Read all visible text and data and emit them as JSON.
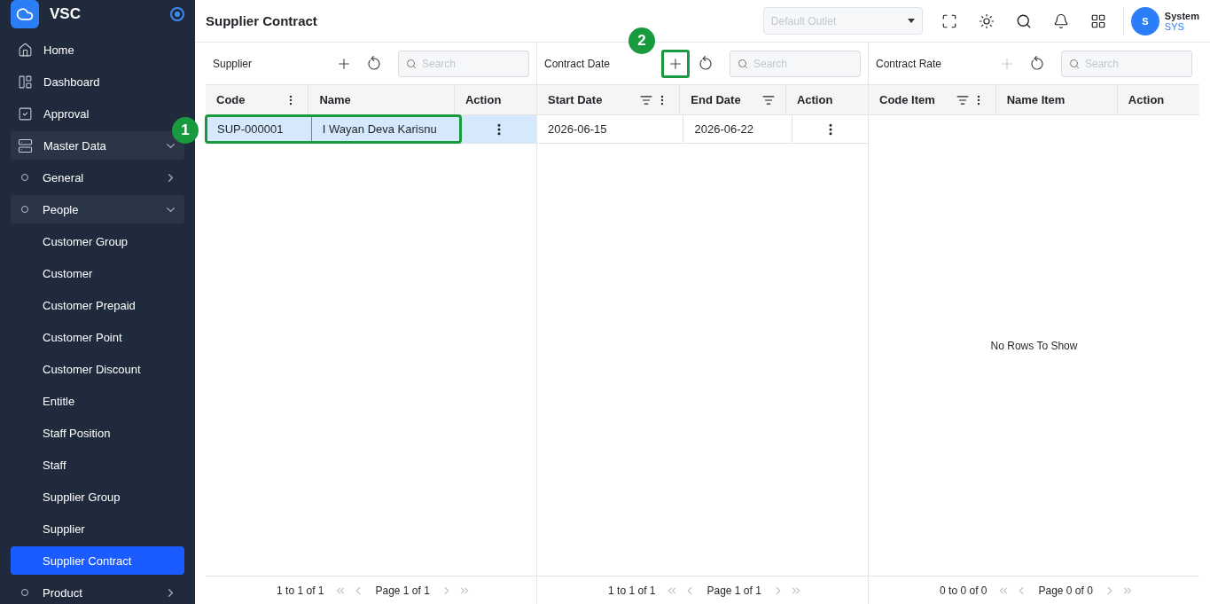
{
  "sidebar": {
    "brand": "VSC",
    "items": [
      {
        "kind": "link",
        "label": "Home",
        "selected": false
      },
      {
        "kind": "link",
        "label": "Dashboard",
        "selected": false
      },
      {
        "kind": "link",
        "label": "Approval",
        "selected": false
      },
      {
        "kind": "group",
        "label": "Master Data",
        "expanded": true,
        "selected": false
      },
      {
        "kind": "sub",
        "label": "General",
        "expanded": false,
        "selected": false
      },
      {
        "kind": "sub",
        "label": "People",
        "expanded": true,
        "selected": false
      },
      {
        "kind": "child",
        "label": "Customer Group",
        "selected": false
      },
      {
        "kind": "child",
        "label": "Customer",
        "selected": false
      },
      {
        "kind": "child",
        "label": "Customer Prepaid",
        "selected": false
      },
      {
        "kind": "child",
        "label": "Customer Point",
        "selected": false
      },
      {
        "kind": "child",
        "label": "Customer Discount",
        "selected": false
      },
      {
        "kind": "child",
        "label": "Entitle",
        "selected": false
      },
      {
        "kind": "child",
        "label": "Staff Position",
        "selected": false
      },
      {
        "kind": "child",
        "label": "Staff",
        "selected": false
      },
      {
        "kind": "child",
        "label": "Supplier Group",
        "selected": false
      },
      {
        "kind": "child",
        "label": "Supplier",
        "selected": false
      },
      {
        "kind": "child",
        "label": "Supplier Contract",
        "selected": true
      },
      {
        "kind": "sub",
        "label": "Product",
        "expanded": false,
        "selected": false
      }
    ]
  },
  "topbar": {
    "title": "Supplier Contract",
    "outlet": {
      "placeholder": "Default Outlet"
    },
    "user": {
      "initial": "S",
      "name": "System",
      "role": "SYS"
    }
  },
  "panels": [
    {
      "title": "Supplier",
      "add_disabled": false,
      "search": {
        "placeholder": "Search"
      },
      "columns": [
        {
          "label": "Code",
          "filter": false,
          "menu": true
        },
        {
          "label": "Name",
          "filter": false,
          "menu": false
        },
        {
          "label": "Action",
          "filter": false,
          "menu": false
        }
      ],
      "rows": [
        {
          "cells": [
            "SUP-000001",
            "I Wayan Deva Karisnu"
          ],
          "selected": true,
          "annotation": "1"
        }
      ],
      "pagination": {
        "summary": "1 to 1 of 1",
        "page": "Page 1 of 1"
      }
    },
    {
      "title": "Contract Date",
      "add_disabled": false,
      "add_annotation": "2",
      "search": {
        "placeholder": "Search"
      },
      "columns": [
        {
          "label": "Start Date",
          "filter": true,
          "menu": true
        },
        {
          "label": "End Date",
          "filter": true,
          "menu": false
        },
        {
          "label": "Action",
          "filter": false,
          "menu": false
        }
      ],
      "rows": [
        {
          "cells": [
            "2026-06-15",
            "2026-06-22"
          ],
          "selected": false
        }
      ],
      "pagination": {
        "summary": "1 to 1 of 1",
        "page": "Page 1 of 1"
      }
    },
    {
      "title": "Contract Rate",
      "add_disabled": true,
      "search": {
        "placeholder": "Search"
      },
      "columns": [
        {
          "label": "Code Item",
          "filter": true,
          "menu": true
        },
        {
          "label": "Name Item",
          "filter": false,
          "menu": false
        },
        {
          "label": "Action",
          "filter": false,
          "menu": false
        }
      ],
      "empty_text": "No Rows To Show",
      "pagination": {
        "summary": "0 to 0 of 0",
        "page": "Page 0 of 0"
      }
    }
  ]
}
